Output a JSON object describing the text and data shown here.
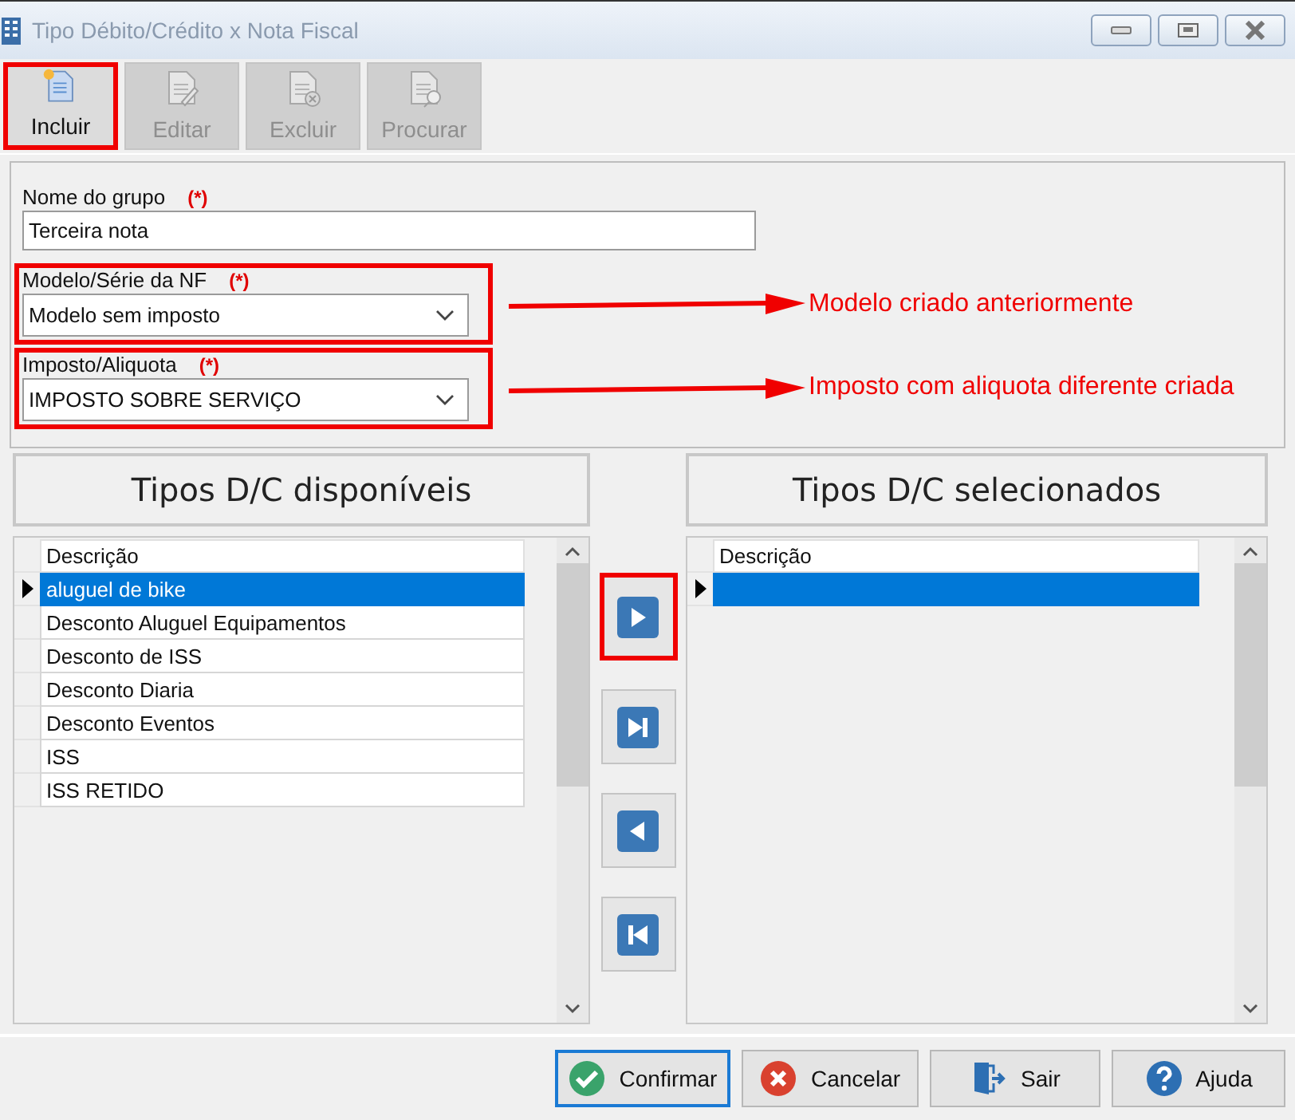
{
  "window": {
    "title": "Tipo Débito/Crédito  x Nota Fiscal"
  },
  "toolbar": [
    {
      "label": "Incluir",
      "kind": "new",
      "disabled": false,
      "highlighted": true
    },
    {
      "label": "Editar",
      "kind": "edit",
      "disabled": true,
      "highlighted": false
    },
    {
      "label": "Excluir",
      "kind": "delete",
      "disabled": true,
      "highlighted": false
    },
    {
      "label": "Procurar",
      "kind": "search",
      "disabled": true,
      "highlighted": false
    }
  ],
  "form": {
    "fields": [
      {
        "label": "Nome do grupo",
        "required_mark": "(*)",
        "kind": "text",
        "value": "Terceira nota",
        "highlighted": false
      },
      {
        "label": "Modelo/Série da NF",
        "required_mark": "(*)",
        "kind": "select",
        "value": "Modelo sem imposto",
        "highlighted": true,
        "annotation": "Modelo criado anteriormente"
      },
      {
        "label": "Imposto/Aliquota",
        "required_mark": "(*)",
        "kind": "select",
        "value": "IMPOSTO SOBRE SERVIÇO",
        "highlighted": true,
        "annotation": "Imposto com aliquota diferente criada"
      }
    ]
  },
  "available": {
    "title": "Tipos D/C disponíveis",
    "column": "Descrição",
    "rows": [
      {
        "text": "aluguel de bike",
        "selected": true
      },
      {
        "text": "Desconto Aluguel Equipamentos",
        "selected": false
      },
      {
        "text": "Desconto de ISS",
        "selected": false
      },
      {
        "text": "Desconto Diaria",
        "selected": false
      },
      {
        "text": "Desconto Eventos",
        "selected": false
      },
      {
        "text": "ISS",
        "selected": false
      },
      {
        "text": "ISS RETIDO",
        "selected": false
      }
    ]
  },
  "move_buttons": [
    {
      "kind": "add",
      "highlighted": true
    },
    {
      "kind": "add_all",
      "highlighted": false
    },
    {
      "kind": "remove",
      "highlighted": false
    },
    {
      "kind": "remove_all",
      "highlighted": false
    }
  ],
  "chosen": {
    "title": "Tipos D/C selecionados",
    "column": "Descrição",
    "rows": [
      {
        "selected": true
      }
    ]
  },
  "buttons": [
    {
      "label": "Confirmar",
      "kind": "confirm",
      "focused": true
    },
    {
      "label": "Cancelar",
      "kind": "cancel",
      "focused": false
    },
    {
      "label": "Sair",
      "kind": "exit",
      "focused": false
    },
    {
      "label": "Ajuda",
      "kind": "help",
      "focused": false
    }
  ]
}
